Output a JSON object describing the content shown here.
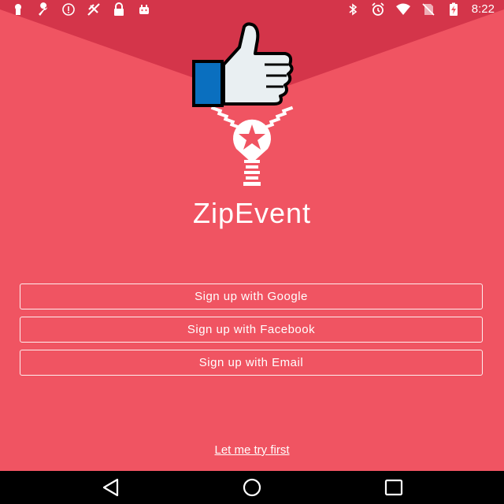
{
  "status_bar": {
    "left_icons": [
      "keyhole-icon",
      "wrench-icon",
      "info-icon",
      "debug-icon",
      "lock-icon",
      "android-icon"
    ],
    "right_icons": [
      "bluetooth-icon",
      "alarm-icon",
      "wifi-icon",
      "no-sim-icon",
      "battery-charging-icon"
    ],
    "time": "8:22"
  },
  "app": {
    "name": "ZipEvent",
    "accent_color": "#f05462",
    "dark_color": "#d4354a"
  },
  "buttons": {
    "google": "Sign up with Google",
    "facebook": "Sign up with Facebook",
    "email": "Sign up with Email"
  },
  "links": {
    "try_first": "Let me try first"
  },
  "nav_bar": {
    "icons": [
      "back-icon",
      "home-icon",
      "recents-icon"
    ]
  }
}
